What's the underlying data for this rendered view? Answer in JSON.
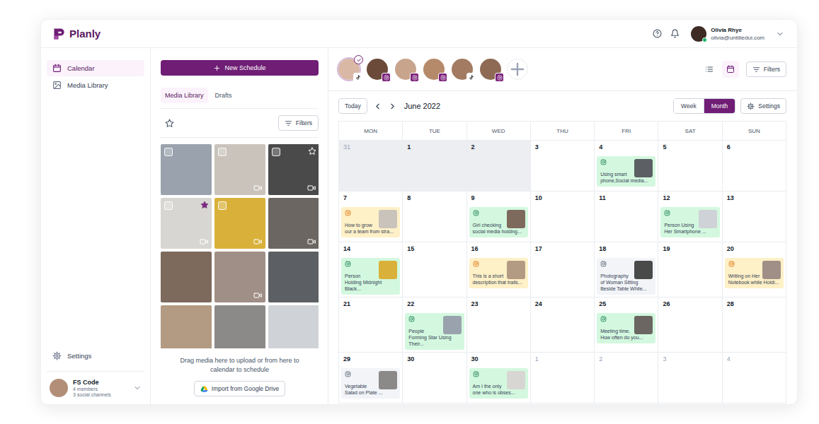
{
  "brand": {
    "name": "Planly"
  },
  "header": {
    "user": {
      "name": "Olivia Rhye",
      "email": "olivia@untitledui.com",
      "online": true
    }
  },
  "sidebar": {
    "items": [
      {
        "label": "Calendar",
        "selected": true,
        "kind": "calendar"
      },
      {
        "label": "Media Library",
        "selected": false,
        "kind": "media"
      }
    ],
    "settings": {
      "label": "Settings"
    },
    "team": {
      "name": "FS Code",
      "members": "4 members",
      "channels": "3 social channels"
    }
  },
  "media_panel": {
    "new_button": "New Schedule",
    "tabs": [
      {
        "label": "Media Library",
        "selected": true
      },
      {
        "label": "Drafts",
        "selected": false
      }
    ],
    "filters": "Filters",
    "items": [
      {
        "checked": false,
        "video": false
      },
      {
        "checked": false,
        "video": true
      },
      {
        "checked": false,
        "starred": false,
        "video": true
      },
      {
        "checked": false,
        "starred": true,
        "video": true
      },
      {
        "checked": false,
        "video": true
      },
      {
        "video": true
      },
      {
        "video": false
      },
      {
        "video": true
      },
      {
        "video": false
      },
      {
        "video": false
      },
      {
        "video": false
      },
      {
        "video": false
      }
    ],
    "hint": "Drag media here to upload or from here to calendar to schedule",
    "import_button": "Import from Google Drive"
  },
  "accounts": [
    {
      "selected": true,
      "kind": "tiktok"
    },
    {
      "selected": false,
      "kind": "instagram"
    },
    {
      "selected": false,
      "kind": "instagram"
    },
    {
      "selected": false,
      "kind": "instagram"
    },
    {
      "selected": false,
      "kind": "tiktok"
    },
    {
      "selected": false,
      "kind": "instagram"
    }
  ],
  "views": [
    {
      "kind": "list",
      "selected": false
    },
    {
      "kind": "calendar",
      "selected": true
    }
  ],
  "filters_button": "Filters",
  "calendar": {
    "today_button": "Today",
    "month": "June 2022",
    "modes": [
      {
        "label": "Week",
        "selected": false
      },
      {
        "label": "Month",
        "selected": true
      }
    ],
    "settings_button": "Settings",
    "weekdays": [
      "MON",
      "TUE",
      "WED",
      "THU",
      "FRI",
      "SAT",
      "SUN"
    ],
    "weeks": [
      [
        {
          "day": "31",
          "past": true,
          "muted": true
        },
        {
          "day": "1",
          "past": true,
          "muted": false
        },
        {
          "day": "2",
          "past": true,
          "muted": false
        },
        {
          "day": "3",
          "past": false,
          "muted": false
        },
        {
          "day": "4",
          "past": false,
          "muted": false,
          "event": {
            "text": "Using smart phone,Social media...",
            "color": "#d3f8df",
            "icon_color": "#087443"
          }
        },
        {
          "day": "5",
          "past": false,
          "muted": false
        },
        {
          "day": "6",
          "past": false,
          "muted": false
        }
      ],
      [
        {
          "day": "7",
          "past": false,
          "muted": false,
          "event": {
            "text": "How to grow our a team from stra...",
            "color": "#fef0c7",
            "icon_color": "#dc6803"
          }
        },
        {
          "day": "8",
          "past": false,
          "muted": false
        },
        {
          "day": "9",
          "past": false,
          "muted": false,
          "event": {
            "text": "Girl checking social media holding...",
            "color": "#d3f8df",
            "icon_color": "#087443"
          }
        },
        {
          "day": "10",
          "past": false,
          "muted": false
        },
        {
          "day": "11",
          "past": false,
          "muted": false
        },
        {
          "day": "12",
          "past": false,
          "muted": false,
          "event": {
            "text": "Person Using Her Smartphone ...",
            "color": "#d3f8df",
            "icon_color": "#087443"
          }
        },
        {
          "day": "13",
          "past": false,
          "muted": false
        }
      ],
      [
        {
          "day": "14",
          "past": false,
          "muted": false,
          "event": {
            "text": "Person Holding Midnight Black...",
            "color": "#d3f8df",
            "icon_color": "#087443"
          }
        },
        {
          "day": "15",
          "past": false,
          "muted": false
        },
        {
          "day": "16",
          "past": false,
          "muted": false,
          "event": {
            "text": "This is a short description that trails...",
            "color": "#fef0c7",
            "icon_color": "#dc6803"
          }
        },
        {
          "day": "17",
          "past": false,
          "muted": false
        },
        {
          "day": "18",
          "past": false,
          "muted": false,
          "event": {
            "text": "Photography of Woman Sitting Beside Table While...",
            "color": "#f2f4f7",
            "icon_color": "#475467"
          }
        },
        {
          "day": "19",
          "past": false,
          "muted": false
        },
        {
          "day": "20",
          "past": false,
          "muted": false,
          "event": {
            "text": "Writing on Her Notebook while Holdi...",
            "color": "#fef0c7",
            "icon_color": "#dc6803"
          }
        }
      ],
      [
        {
          "day": "21",
          "past": false,
          "muted": false
        },
        {
          "day": "22",
          "past": false,
          "muted": false,
          "event": {
            "text": "People Forming Star Using Their...",
            "color": "#d3f8df",
            "icon_color": "#087443"
          }
        },
        {
          "day": "23",
          "past": false,
          "muted": false
        },
        {
          "day": "24",
          "past": false,
          "muted": false
        },
        {
          "day": "25",
          "past": false,
          "muted": false,
          "event": {
            "text": "Meeting time. How often do you...",
            "color": "#d3f8df",
            "icon_color": "#087443"
          }
        },
        {
          "day": "26",
          "past": false,
          "muted": false
        },
        {
          "day": "28",
          "past": false,
          "muted": false
        }
      ],
      [
        {
          "day": "29",
          "past": false,
          "muted": false,
          "event": {
            "text": "Vegetable Salad on Plate ...",
            "color": "#f2f4f7",
            "icon_color": "#475467"
          }
        },
        {
          "day": "30",
          "past": false,
          "muted": false
        },
        {
          "day": "30",
          "past": false,
          "muted": false,
          "event": {
            "text": "Am I the only one who is obses...",
            "color": "#d3f8df",
            "icon_color": "#087443"
          }
        },
        {
          "day": "1",
          "past": false,
          "muted": true
        },
        {
          "day": "2",
          "past": false,
          "muted": true
        },
        {
          "day": "3",
          "past": false,
          "muted": true
        },
        {
          "day": "4",
          "past": false,
          "muted": true
        }
      ]
    ]
  }
}
